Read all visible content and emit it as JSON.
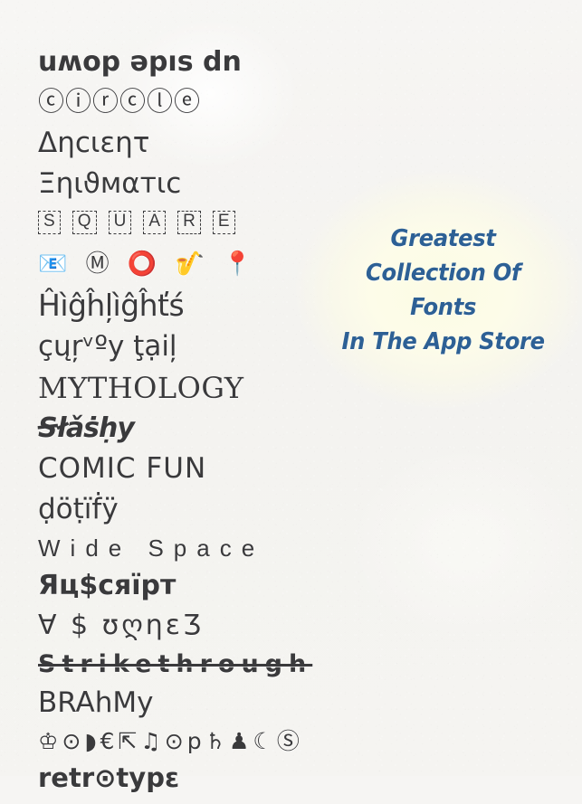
{
  "app": {
    "background_color": "#f5f4f1",
    "text_color": "#3a3a3c",
    "accent_color": "#2d6095",
    "glow_color": "#fcfbe4"
  },
  "samples": [
    {
      "name": "upside-down",
      "text": "uʍop ǝpıs dn"
    },
    {
      "name": "circle",
      "text": "ⓒⓘⓡⓒⓛⓔ"
    },
    {
      "name": "ancient",
      "text": "Δηcιεητ"
    },
    {
      "name": "enigmatic",
      "text": "Ξηιϑмαтιc"
    },
    {
      "name": "square",
      "letters": [
        "S",
        "Q",
        "U",
        "A",
        "R",
        "E"
      ]
    },
    {
      "name": "emoji",
      "glyphs": [
        "📧",
        "Ⓜ",
        "⭕",
        "🎷",
        "📍"
      ]
    },
    {
      "name": "highlights",
      "text": "Ĥìĝĥļìĝĥťś"
    },
    {
      "name": "curvy-tail",
      "text": "çųŗᵛºy ţạiļ"
    },
    {
      "name": "mythology",
      "text": "MYTHOLOGY"
    },
    {
      "name": "slashy",
      "text": "Ꞩłǎṡḥy"
    },
    {
      "name": "comic-fun",
      "text": "COMIC FUN"
    },
    {
      "name": "dotify",
      "text": "ḍöṭïḟÿ"
    },
    {
      "name": "wide-space",
      "text": "Wide Space"
    },
    {
      "name": "russcript",
      "text": "Яц$сяïpт"
    },
    {
      "name": "vowels",
      "text": "∀ $ ʊღηεƷ"
    },
    {
      "name": "strikethrough",
      "text": "Strikethrough"
    },
    {
      "name": "brahmy",
      "text": "BRAhMy"
    },
    {
      "name": "symbols",
      "text": "♔⊙◗€⇱♫⊙p♄♟☾Ⓢ"
    },
    {
      "name": "retrotype",
      "text": "retr⊙typε"
    }
  ],
  "promo": {
    "tagline": "Greatest\nCollection Of\nFonts\nIn The App Store"
  }
}
